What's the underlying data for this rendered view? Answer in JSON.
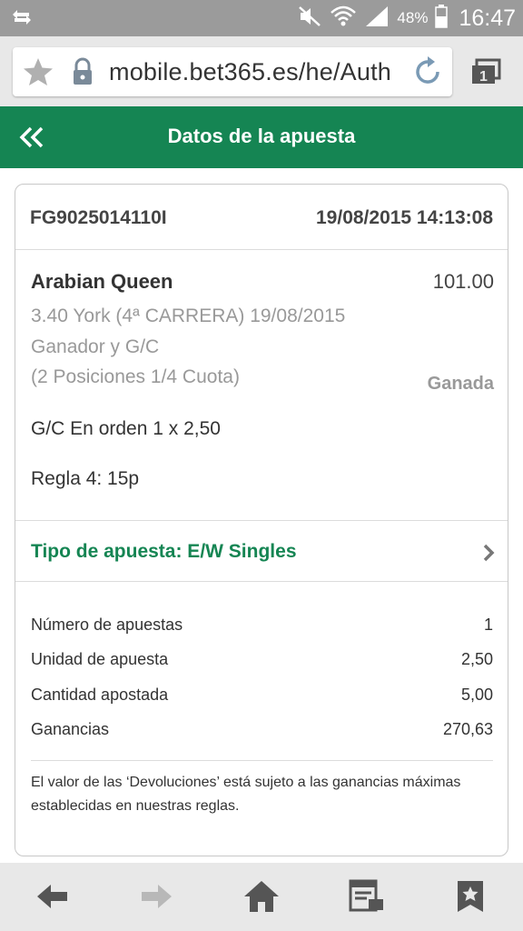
{
  "status_bar": {
    "battery": "48%",
    "time": "16:47",
    "icons": [
      "sync-icon",
      "mute-icon",
      "wifi-icon",
      "signal-icon",
      "battery-icon"
    ]
  },
  "browser": {
    "url": "mobile.bet365.es/he/Auth",
    "icons": [
      "bookmark-star-icon",
      "lock-icon",
      "reload-icon",
      "tabs-icon"
    ]
  },
  "header": {
    "title": "Datos de la apuesta",
    "back_icon": "double-chevron-left-icon"
  },
  "bet": {
    "reference": "FG9025014110I",
    "datetime": "19/08/2015 14:13:08",
    "selection": {
      "name": "Arabian Queen",
      "odds": "101.00",
      "race": "3.40 York (4ª CARRERA) 19/08/2015",
      "market": "Ganador y G/C",
      "terms": "(2 Posiciones 1/4 Cuota)",
      "status": "Ganada",
      "place_line": "G/C  En orden 1 x 2,50",
      "rule": "Regla 4: 15p"
    },
    "bet_type": "Tipo de apuesta: E/W Singles"
  },
  "summary": [
    {
      "label": "Número de apuestas",
      "value": "1"
    },
    {
      "label": "Unidad de apuesta",
      "value": "2,50"
    },
    {
      "label": "Cantidad apostada",
      "value": "5,00"
    },
    {
      "label": "Ganancias",
      "value": "270,63"
    }
  ],
  "disclaimer": "El valor de las ‘Devoluciones’ está sujeto a las ganancias máximas establecidas en nuestras reglas.",
  "bottom_nav": [
    "back-arrow-icon",
    "forward-arrow-icon",
    "home-icon",
    "reading-list-icon",
    "bookmarks-icon"
  ],
  "colors": {
    "brand_green": "#158553",
    "status_bar": "#9b9b9b",
    "chrome": "#e8e8e8"
  }
}
